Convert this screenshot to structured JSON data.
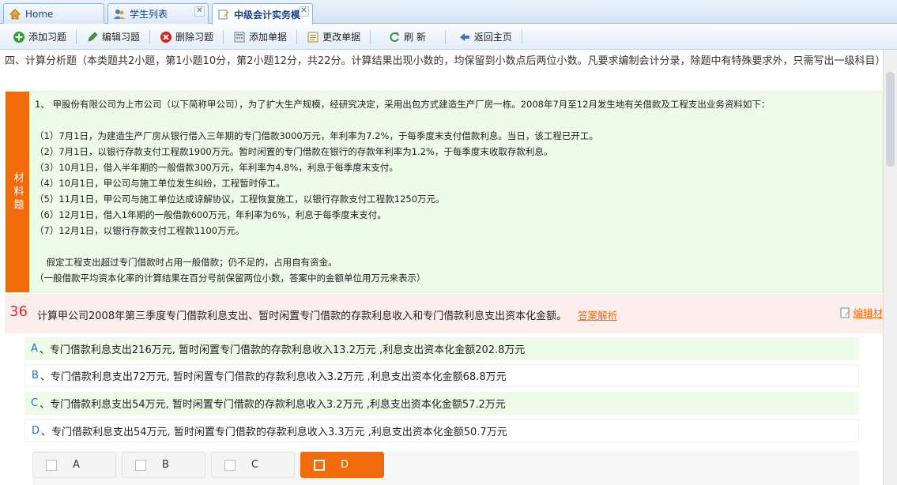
{
  "tabs": [
    {
      "label": "Home",
      "icon": "home-icon"
    },
    {
      "label": "学生列表",
      "icon": "users-icon",
      "close": "✕"
    },
    {
      "label": "中级会计实务模",
      "icon": "edit-icon",
      "close": "✕"
    }
  ],
  "toolbar": {
    "add": "添加习题",
    "edit": "编辑习题",
    "delete": "删除习题",
    "add_list": "添加单据",
    "change_list": "更改单据",
    "refresh": "刷 新",
    "back": "返回主页"
  },
  "section": {
    "description": "四、计算分析题（本类题共2小题，第1小题10分，第2小题12分，共22分。计算结果出现小数的，均保留到小数点后两位小数。凡要求编制会计分录，除题中有特殊要求外，只需写出一级科目）"
  },
  "material": {
    "label": "材料题",
    "intro": "1、    甲股份有限公司为上市公司（以下简称甲公司），为了扩大生产规模，经研究决定，采用出包方式建造生产厂房一栋。2008年7月至12月发生地有关借款及工程支出业务资料如下：",
    "items": [
      "（1）7月1日，为建造生产厂房从银行借入三年期的专门借款3000万元，年利率为7.2%，于每季度末支付借款利息。当日，该工程已开工。",
      "（2）7月1日，以银行存款支付工程款1900万元。暂时闲置的专门借款在银行的存款年利率为1.2%，于每季度末收取存款利息。",
      "（3）10月1日，借入半年期的一般借款300万元，年利率为4.8%，利息于每季度末支付。",
      "（4）10月1日，甲公司与施工单位发生纠纷，工程暂时停工。",
      "（5）11月1日，甲公司与施工单位达成谅解协议，工程恢复施工，以银行存款支付工程款1250万元。",
      "（6）12月1日，借入1年期的一般借款600万元，年利率为6%，利息于每季度末支付。",
      "（7）12月1日，以银行存款支付工程款1100万元。"
    ],
    "note1": "    假定工程支出超过专门借款时占用一般借款；仍不足的，占用自有资金。",
    "note2": "（一般借款平均资本化率的计算结果在百分号前保留两位小数，答案中的金额单位用万元来表示）"
  },
  "question": {
    "number": "36",
    "text": "计算甲公司2008年第三季度专门借款利息支出、暂时闲置专门借款的存款利息收入和专门借款利息支出资本化金额。",
    "analysis_link": "答案解析",
    "edit_link": "编辑材"
  },
  "options": [
    {
      "letter": "A",
      "text": " 、专门借款利息支出216万元, 暂时闲置专门借款的存款利息收入13.2万元 ,利息支出资本化金额202.8万元"
    },
    {
      "letter": "B",
      "text": " 、专门借款利息支出72万元, 暂时闲置专门借款的存款利息收入3.2万元 ,利息支出资本化金额68.8万元"
    },
    {
      "letter": "C",
      "text": " 、专门借款利息支出54万元, 暂时闲置专门借款的存款利息收入3.2万元 ,利息支出资本化金额57.2万元"
    },
    {
      "letter": "D",
      "text": " 、专门借款利息支出54万元, 暂时闲置专门借款的存款利息收入3.3万元 ,利息支出资本化金额50.7万元"
    }
  ],
  "choices": [
    "A",
    "B",
    "C",
    "D"
  ],
  "selected_choice": "D",
  "colors": {
    "accent_orange": "#f26b0b",
    "material_bg": "#eefbe9",
    "question_bg": "#fdeeee",
    "link_blue": "#1f6fd1"
  }
}
